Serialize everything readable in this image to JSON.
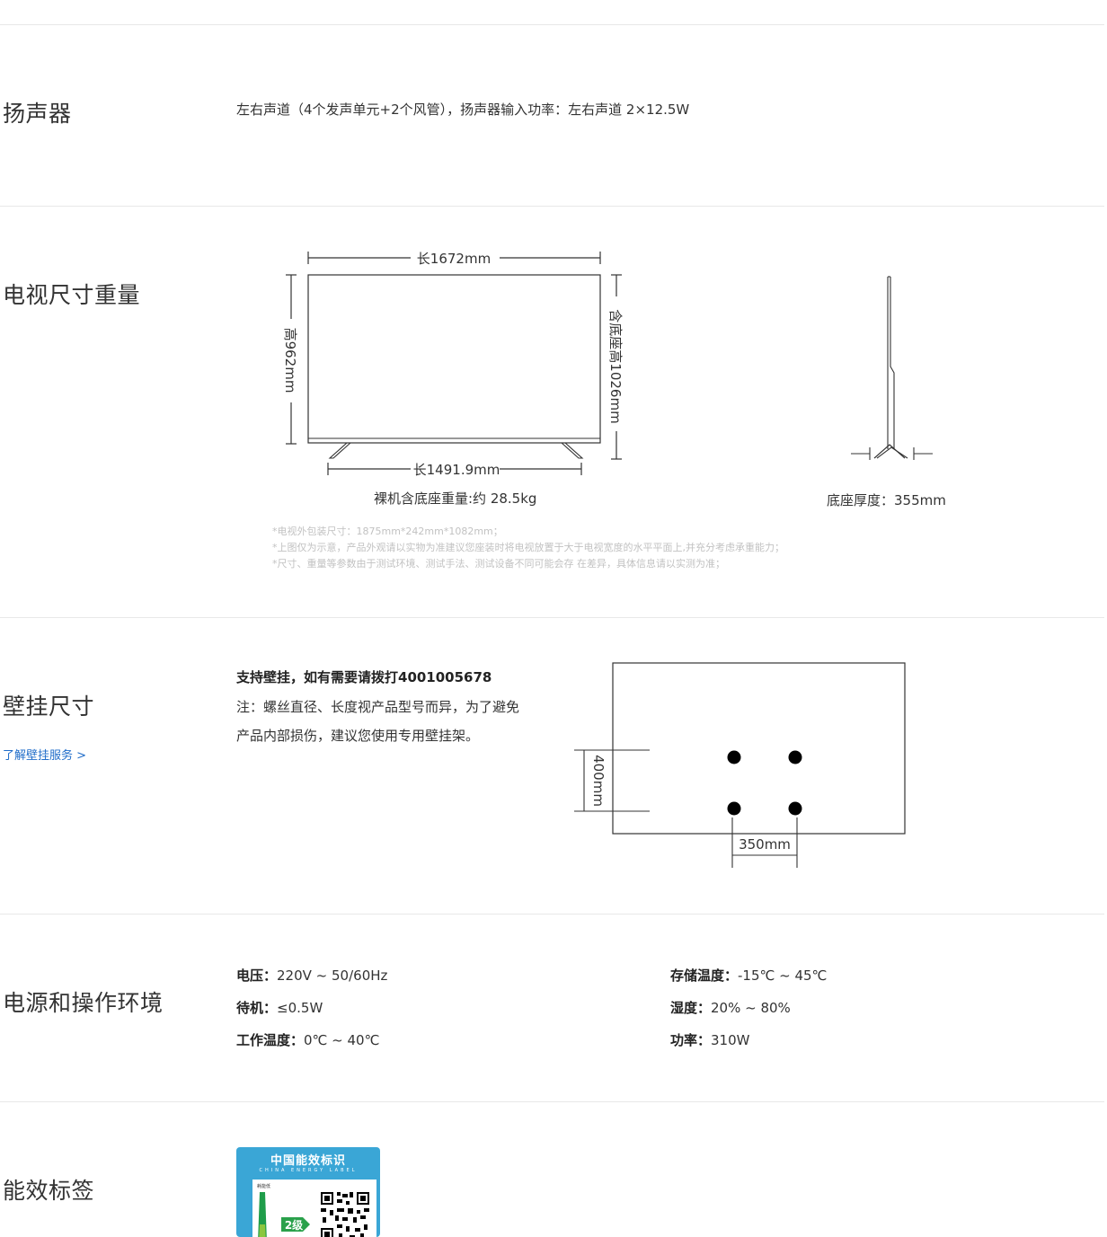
{
  "speaker": {
    "title": "扬声器",
    "desc": "左右声道（4个发声单元+2个风管），扬声器输入功率：左右声道 2×12.5W"
  },
  "size": {
    "title": "电视尺寸重量",
    "width_label": "长1672mm",
    "height_label": "高962mm",
    "height_with_base_label": "含底座高1026mm",
    "base_width_label": "长1491.9mm",
    "weight_label": "裸机含底座重量:约 28.5kg",
    "depth_label": "底座厚度：355mm",
    "notes": [
      "*电视外包装尺寸：1875mm*242mm*1082mm；",
      "*上图仅为示意，产品外观请以实物为准建议您座装时将电视放置于大于电视宽度的水平平面上,并充分考虑承重能力；",
      "*尺寸、重量等参数由于测试环境、测试手法、测试设备不同可能会存 在差异，具体信息请以实测为准；"
    ]
  },
  "wall": {
    "title": "壁挂尺寸",
    "link": "了解壁挂服务 >",
    "support": "支持壁挂，如有需要请拨打4001005678",
    "note_line1": "注：螺丝直径、长度视产品型号而异，为了避免",
    "note_line2": "产品内部损伤，建议您使用专用壁挂架。",
    "vertical_label": "400mm",
    "horizontal_label": "350mm"
  },
  "power": {
    "title": "电源和操作环境",
    "left": [
      {
        "key": "电压：",
        "value": "220V ~ 50/60Hz"
      },
      {
        "key": "待机：",
        "value": "≤0.5W"
      },
      {
        "key": "工作温度：",
        "value": "0℃ ~ 40℃"
      }
    ],
    "right": [
      {
        "key": "存储温度：",
        "value": "-15℃ ~ 45℃"
      },
      {
        "key": "湿度：",
        "value": "20% ~ 80%"
      },
      {
        "key": "功率：",
        "value": "310W"
      }
    ]
  },
  "energy": {
    "title": "能效标签",
    "label_title": "中国能效标识",
    "label_sub": "CHINA ENERGY LABEL",
    "label_low": "耗能低",
    "grade": "2级"
  }
}
